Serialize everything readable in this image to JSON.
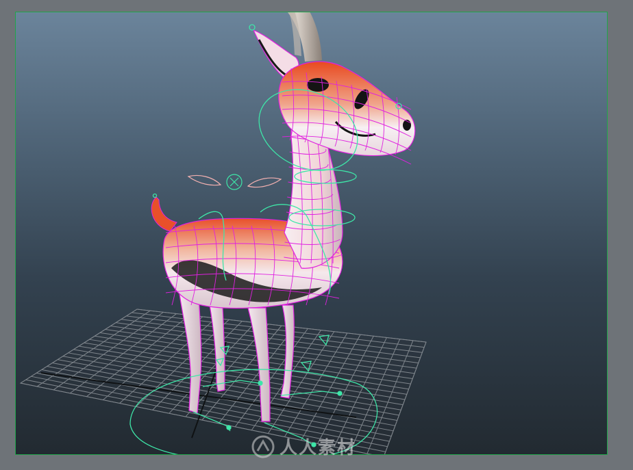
{
  "viewport": {
    "background_top": "#6b849b",
    "background_bottom": "#222a31",
    "border_color": "#1fa64a"
  },
  "scene": {
    "subject": "gazelle-rig",
    "mesh_wire_color": "#e020e0",
    "control_curve_color": "#3ee6a8",
    "grid_color": "#8a9096",
    "body_colors": [
      "#e8502a",
      "#f4e6ea",
      "#1a1a1a"
    ]
  },
  "watermark": {
    "text": "人人素材",
    "logo_icon": "rr-sc-logo-icon"
  }
}
